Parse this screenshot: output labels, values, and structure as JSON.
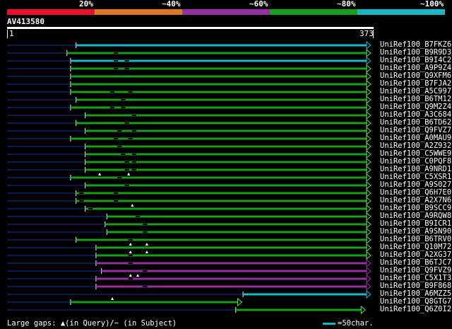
{
  "legend": {
    "segments": [
      {
        "color": "#e8102c"
      },
      {
        "color": "#e07820"
      },
      {
        "color": "#9630a0"
      },
      {
        "color": "#18a018"
      },
      {
        "color": "#18b8c8"
      }
    ],
    "labels": [
      "20%",
      "~40%",
      "~60%",
      "~80%",
      "~100%"
    ]
  },
  "query": {
    "name": "AV413580",
    "start": "1",
    "end": "373"
  },
  "hits": [
    {
      "name": "UniRef100_B7FKZ6",
      "color": "#18b8c8",
      "start": 0.19,
      "end": 1.0,
      "gaps": [],
      "arrow": true
    },
    {
      "name": "UniRef100_B9R9D3",
      "color": "#18a018",
      "start": 0.165,
      "end": 1.0,
      "gaps": [
        0.3
      ],
      "arrow": true
    },
    {
      "name": "UniRef100_B9I4C2",
      "color": "#18b8c8",
      "start": 0.175,
      "end": 1.0,
      "gaps": [
        0.3,
        0.33
      ],
      "arrow": true
    },
    {
      "name": "UniRef100_A9P9Z4",
      "color": "#18a018",
      "start": 0.175,
      "end": 1.0,
      "gaps": [
        0.3,
        0.33
      ],
      "arrow": true
    },
    {
      "name": "UniRef100_Q9XFM6",
      "color": "#18a018",
      "start": 0.175,
      "end": 1.0,
      "gaps": [],
      "arrow": true
    },
    {
      "name": "UniRef100_B7FJA2",
      "color": "#18a018",
      "start": 0.175,
      "end": 1.0,
      "gaps": [],
      "arrow": true
    },
    {
      "name": "UniRef100_A5C997",
      "color": "#18a018",
      "start": 0.175,
      "end": 1.0,
      "gaps": [
        0.29,
        0.34
      ],
      "arrow": true
    },
    {
      "name": "UniRef100_B6TM12",
      "color": "#18a018",
      "start": 0.19,
      "end": 1.0,
      "gaps": [
        0.32
      ],
      "arrow": true
    },
    {
      "name": "UniRef100_Q9M2Z4",
      "color": "#18a018",
      "start": 0.175,
      "end": 1.0,
      "gaps": [
        0.29,
        0.32
      ],
      "arrow": true
    },
    {
      "name": "UniRef100_A3C684",
      "color": "#18a018",
      "start": 0.215,
      "end": 1.0,
      "gaps": [
        0.35
      ],
      "arrow": true
    },
    {
      "name": "UniRef100_B6TD62",
      "color": "#18a018",
      "start": 0.19,
      "end": 1.0,
      "gaps": [
        0.33
      ],
      "arrow": true
    },
    {
      "name": "UniRef100_Q9FVZ7",
      "color": "#18a018",
      "start": 0.215,
      "end": 1.0,
      "gaps": [
        0.31,
        0.35
      ],
      "arrow": true
    },
    {
      "name": "UniRef100_A0MAU9",
      "color": "#18a018",
      "start": 0.175,
      "end": 1.0,
      "gaps": [
        0.3,
        0.34
      ],
      "arrow": true
    },
    {
      "name": "UniRef100_A2Z932",
      "color": "#18a018",
      "start": 0.215,
      "end": 1.0,
      "gaps": [
        0.31
      ],
      "arrow": true
    },
    {
      "name": "UniRef100_C5WWE9",
      "color": "#18a018",
      "start": 0.215,
      "end": 1.0,
      "gaps": [
        0.32,
        0.35
      ],
      "arrow": true
    },
    {
      "name": "UniRef100_C0PQF8",
      "color": "#18a018",
      "start": 0.215,
      "end": 1.0,
      "gaps": [
        0.33,
        0.35
      ],
      "arrow": true
    },
    {
      "name": "UniRef100_A9NRD1",
      "color": "#18a018",
      "start": 0.215,
      "end": 1.0,
      "gaps": [
        0.33,
        0.35
      ],
      "arrow": true
    },
    {
      "name": "UniRef100_C5XSR1",
      "color": "#18a018",
      "start": 0.175,
      "end": 1.0,
      "gaps": [
        0.31
      ],
      "arrow": true
    },
    {
      "name": "UniRef100_A9S027",
      "color": "#18a018",
      "start": 0.215,
      "end": 1.0,
      "gaps": [
        0.33
      ],
      "arrow": true
    },
    {
      "name": "UniRef100_Q6H7E0",
      "color": "#18a018",
      "start": 0.19,
      "end": 1.0,
      "gaps": [
        0.205,
        0.3
      ],
      "arrow": true
    },
    {
      "name": "UniRef100_A2X7N6",
      "color": "#18a018",
      "start": 0.19,
      "end": 1.0,
      "gaps": [
        0.205,
        0.3
      ],
      "arrow": true
    },
    {
      "name": "UniRef100_B9SCC9",
      "color": "#18a018",
      "start": 0.215,
      "end": 1.0,
      "gaps": [
        0.23
      ],
      "arrow": true
    },
    {
      "name": "UniRef100_A9RQW8",
      "color": "#18a018",
      "start": 0.275,
      "end": 1.0,
      "gaps": [
        0.36
      ],
      "arrow": true
    },
    {
      "name": "UniRef100_B9ICR1",
      "color": "#18a018",
      "start": 0.27,
      "end": 1.0,
      "gaps": [
        0.38
      ],
      "arrow": true
    },
    {
      "name": "UniRef100_A9SN90",
      "color": "#18a018",
      "start": 0.275,
      "end": 1.0,
      "gaps": [
        0.38
      ],
      "arrow": true
    },
    {
      "name": "UniRef100_B6TRV0",
      "color": "#18a018",
      "start": 0.19,
      "end": 1.0,
      "gaps": [
        0.34
      ],
      "arrow": true
    },
    {
      "name": "UniRef100_Q10M72",
      "color": "#18a018",
      "start": 0.245,
      "end": 1.0,
      "gaps": [],
      "arrow": true
    },
    {
      "name": "UniRef100_A2XG37",
      "color": "#18a018",
      "start": 0.245,
      "end": 1.0,
      "gaps": [
        0.34
      ],
      "arrow": true
    },
    {
      "name": "UniRef100_B6TJC7",
      "color": "#9630a0",
      "start": 0.245,
      "end": 1.0,
      "gaps": [
        0.34
      ],
      "arrow": true
    },
    {
      "name": "UniRef100_Q9FVZ9",
      "color": "#9630a0",
      "start": 0.26,
      "end": 1.0,
      "gaps": [
        0.38
      ],
      "arrow": true
    },
    {
      "name": "UniRef100_C5X1T3",
      "color": "#9630a0",
      "start": 0.245,
      "end": 1.0,
      "gaps": [
        0.34
      ],
      "arrow": true
    },
    {
      "name": "UniRef100_B9F868",
      "color": "#9630a0",
      "start": 0.245,
      "end": 1.0,
      "gaps": [
        0.38
      ],
      "arrow": true
    },
    {
      "name": "UniRef100_A6MZZ5",
      "color": "#18b8c8",
      "start": 0.65,
      "end": 1.0,
      "gaps": [],
      "arrow": true
    },
    {
      "name": "UniRef100_Q8GTG7",
      "color": "#18a018",
      "start": 0.175,
      "end": 0.645,
      "gaps": [],
      "arrow": true
    },
    {
      "name": "UniRef100_Q6Z0I2",
      "color": "#18a018",
      "start": 0.63,
      "end": 0.985,
      "gaps": [],
      "arrow": true
    }
  ],
  "query_gap_marks": [
    {
      "row": 17,
      "pos": 0.255
    },
    {
      "row": 17,
      "pos": 0.335
    },
    {
      "row": 21,
      "pos": 0.345
    },
    {
      "row": 26,
      "pos": 0.34
    },
    {
      "row": 26,
      "pos": 0.385
    },
    {
      "row": 27,
      "pos": 0.34
    },
    {
      "row": 27,
      "pos": 0.385
    },
    {
      "row": 30,
      "pos": 0.34
    },
    {
      "row": 30,
      "pos": 0.36
    },
    {
      "row": 33,
      "pos": 0.29
    }
  ],
  "footer": {
    "gaps_text": "Large gaps: ▲(in Query)/− (in Subject)",
    "scale_text": "=50char.",
    "scale_color": "#00c0c8"
  }
}
